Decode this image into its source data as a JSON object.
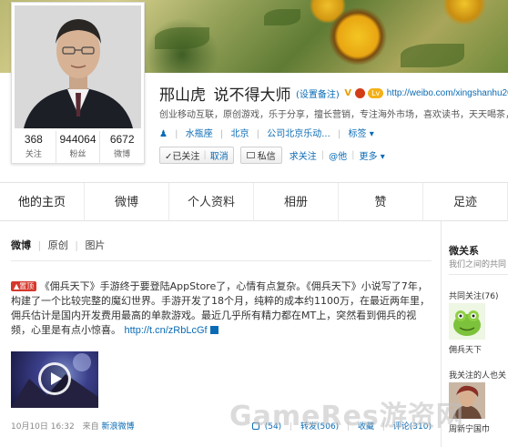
{
  "profile": {
    "name": "邢山虎_说不得大师",
    "remark_link": "(设置备注)",
    "verified_badge": "V",
    "level_badge": "Lv",
    "url": "http://weibo.com/xingshanhu20",
    "bio": "创业移动互联，原创游戏，乐于分享，擅长营销，专注海外市场，喜欢读书，天天喝茶，讲",
    "gender_icon": "person-icon",
    "location": "水瓶座",
    "city": "北京",
    "company": "公司北京乐动...",
    "tags_label": "标签",
    "stats": [
      {
        "value": "368",
        "label": "关注"
      },
      {
        "value": "944064",
        "label": "粉丝"
      },
      {
        "value": "6672",
        "label": "微博"
      }
    ],
    "actions": {
      "followed": "✓已关注",
      "cancel": "取消",
      "message": "私信",
      "ask_follow": "求关注",
      "at": "@他",
      "more": "更多"
    }
  },
  "tabs": [
    {
      "label": "他的主页",
      "active": true
    },
    {
      "label": "微博",
      "active": false
    },
    {
      "label": "个人资料",
      "active": false
    },
    {
      "label": "相册",
      "active": false
    },
    {
      "label": "赞",
      "active": false
    },
    {
      "label": "足迹",
      "active": false
    }
  ],
  "feed": {
    "filters": [
      "微博",
      "原创",
      "图片"
    ],
    "post": {
      "pin_label": "置顶",
      "text": "《佣兵天下》手游终于要登陆AppStore了，心情有点复杂。《佣兵天下》小说写了7年，构建了一个比较完整的魔幻世界。手游开发了18个月，纯粹的成本约1100万，在最近两年里，佣兵估计是国内开发费用最高的单款游戏。最近几乎所有精力都在MT上，突然看到佣兵的视频，心里是有点小惊喜。",
      "link": "http://t.cn/zRbLcGf",
      "time": "10月10日 16:32",
      "source_prefix": "来自",
      "source": "新浪微博",
      "likes": "(54)",
      "reposts": "转发(506)",
      "favorite": "收藏",
      "comments": "评论(310)"
    }
  },
  "sidebar": {
    "title": "微关系",
    "subtitle": "我们之间的共同",
    "common_follow": "共同关注(76)",
    "common_name": "佣兵天下",
    "also_follow": "我关注的人也关",
    "also_name": "周新宁国巾"
  },
  "watermark": "GameRes游资网",
  "colors": {
    "link": "#0a6bb5",
    "pin": "#d6382c",
    "level": "#f3b118"
  }
}
